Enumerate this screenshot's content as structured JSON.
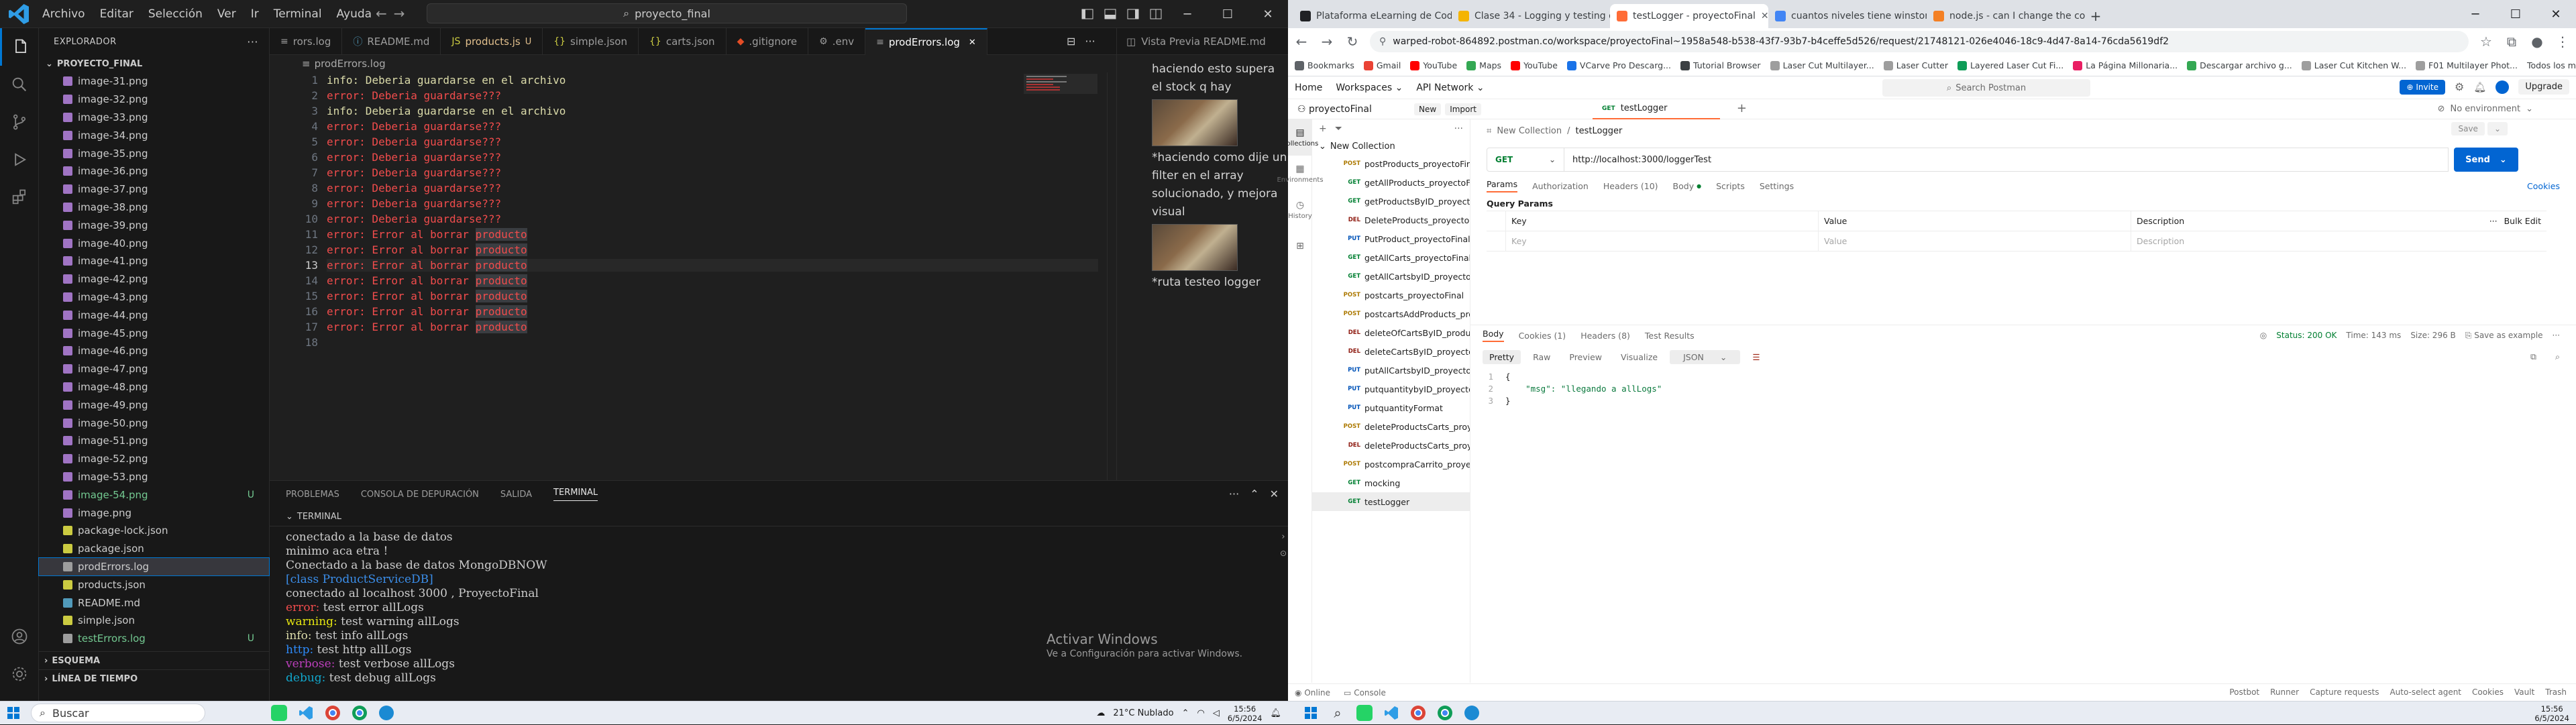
{
  "vscode": {
    "menu": [
      "Archivo",
      "Editar",
      "Selección",
      "Ver",
      "Ir",
      "Terminal",
      "Ayuda"
    ],
    "search_text": "proyecto_final",
    "explorer_title": "EXPLORADOR",
    "project_name": "PROYECTO_FINAL",
    "files": [
      {
        "name": "image-31.png",
        "type": "img"
      },
      {
        "name": "image-32.png",
        "type": "img"
      },
      {
        "name": "image-33.png",
        "type": "img"
      },
      {
        "name": "image-34.png",
        "type": "img"
      },
      {
        "name": "image-35.png",
        "type": "img"
      },
      {
        "name": "image-36.png",
        "type": "img"
      },
      {
        "name": "image-37.png",
        "type": "img"
      },
      {
        "name": "image-38.png",
        "type": "img"
      },
      {
        "name": "image-39.png",
        "type": "img"
      },
      {
        "name": "image-40.png",
        "type": "img"
      },
      {
        "name": "image-41.png",
        "type": "img"
      },
      {
        "name": "image-42.png",
        "type": "img"
      },
      {
        "name": "image-43.png",
        "type": "img"
      },
      {
        "name": "image-44.png",
        "type": "img"
      },
      {
        "name": "image-45.png",
        "type": "img"
      },
      {
        "name": "image-46.png",
        "type": "img"
      },
      {
        "name": "image-47.png",
        "type": "img"
      },
      {
        "name": "image-48.png",
        "type": "img"
      },
      {
        "name": "image-49.png",
        "type": "img"
      },
      {
        "name": "image-50.png",
        "type": "img"
      },
      {
        "name": "image-51.png",
        "type": "img"
      },
      {
        "name": "image-52.png",
        "type": "img"
      },
      {
        "name": "image-53.png",
        "type": "img"
      },
      {
        "name": "image-54.png",
        "type": "img-new",
        "badge": "U"
      },
      {
        "name": "image.png",
        "type": "img"
      },
      {
        "name": "package-lock.json",
        "type": "json"
      },
      {
        "name": "package.json",
        "type": "json"
      },
      {
        "name": "prodErrors.log",
        "type": "log",
        "selected": true
      },
      {
        "name": "products.json",
        "type": "json"
      },
      {
        "name": "README.md",
        "type": "md"
      },
      {
        "name": "simple.json",
        "type": "json"
      },
      {
        "name": "testErrors.log",
        "type": "log-new",
        "badge": "U"
      }
    ],
    "outline_sections": [
      "ESQUEMA",
      "LÍNEA DE TIEMPO"
    ],
    "tabs": [
      {
        "label": "rors.log",
        "icon": "≡",
        "color": "#9d9d9d"
      },
      {
        "label": "README.md",
        "icon": "ⓘ",
        "color": "#519aba"
      },
      {
        "label": "products.js",
        "icon": "JS",
        "color": "#cbcb41",
        "modified": "U"
      },
      {
        "label": "simple.json",
        "icon": "{}",
        "color": "#cbcb41"
      },
      {
        "label": "carts.json",
        "icon": "{}",
        "color": "#cbcb41"
      },
      {
        "label": ".gitignore",
        "icon": "◆",
        "color": "#e44d26"
      },
      {
        "label": ".env",
        "icon": "⚙",
        "color": "#9d9d9d"
      },
      {
        "label": "prodErrors.log",
        "icon": "≡",
        "color": "#9d9d9d",
        "active": true
      }
    ],
    "breadcrumb": "prodErrors.log",
    "code_lines": [
      {
        "level": "info",
        "text": " Deberia guardarse en el archivo"
      },
      {
        "level": "error",
        "text": " Deberia guardarse???"
      },
      {
        "level": "info",
        "text": " Deberia guardarse en el archivo"
      },
      {
        "level": "error",
        "text": " Deberia guardarse???"
      },
      {
        "level": "error",
        "text": " Deberia guardarse???"
      },
      {
        "level": "error",
        "text": " Deberia guardarse???"
      },
      {
        "level": "error",
        "text": " Deberia guardarse???"
      },
      {
        "level": "error",
        "text": " Deberia guardarse???"
      },
      {
        "level": "error",
        "text": " Deberia guardarse???"
      },
      {
        "level": "error",
        "text": " Deberia guardarse???"
      },
      {
        "level": "error",
        "text": " Error al borrar ",
        "hl": "producto"
      },
      {
        "level": "error",
        "text": " Error al borrar ",
        "hl": "producto"
      },
      {
        "level": "error",
        "text": " Error al borrar ",
        "hl": "producto"
      },
      {
        "level": "error",
        "text": " Error al borrar ",
        "hl": "producto"
      },
      {
        "level": "error",
        "text": " Error al borrar ",
        "hl": "producto"
      },
      {
        "level": "error",
        "text": " Error al borrar ",
        "hl": "producto"
      },
      {
        "level": "error",
        "text": " Error al borrar ",
        "hl": "producto"
      },
      {
        "level": "",
        "text": ""
      }
    ],
    "preview": {
      "tab_label": "Vista Previa README.md",
      "text_blocks": [
        "haciendo esto supera el stock q hay",
        "*haciendo como dije un filter en el array solucionado, y mejora visual",
        "*ruta testeo logger"
      ]
    },
    "panel_tabs": [
      "PROBLEMAS",
      "CONSOLA DE DEPURACIÓN",
      "SALIDA",
      "TERMINAL"
    ],
    "terminal_label": "TERMINAL",
    "terminal_lines": [
      {
        "cls": "",
        "text": "conectado a la base de datos"
      },
      {
        "cls": "",
        "text": "minimo aca etra !"
      },
      {
        "cls": "",
        "text": "Conectado a la base de datos MongoDBNOW"
      },
      {
        "cls": "t-cls",
        "text": "[class ProductServiceDB]"
      },
      {
        "cls": "",
        "text": "conectado al localhost 3000 , ProyectoFinal"
      },
      {
        "cls": "t-err",
        "prefix": "error:",
        "text": " test error allLogs"
      },
      {
        "cls": "t-warn",
        "prefix": "warning:",
        "text": " test warning allLogs"
      },
      {
        "cls": "t-info",
        "prefix": "info:",
        "text": " test info allLogs"
      },
      {
        "cls": "t-http",
        "prefix": "http:",
        "text": " test http allLogs"
      },
      {
        "cls": "t-verb",
        "prefix": "verbose:",
        "text": " test verbose allLogs"
      },
      {
        "cls": "t-dbg",
        "prefix": "debug:",
        "text": " test debug allLogs"
      }
    ],
    "activate_title": "Activar Windows",
    "activate_sub": "Ve a Configuración para activar Windows."
  },
  "chrome": {
    "tabs": [
      {
        "label": "Plataforma eLearning de Coder",
        "fav": "#202124"
      },
      {
        "label": "Clase 34 - Logging y testing d",
        "fav": "#f4b400"
      },
      {
        "label": "testLogger - proyectoFinal",
        "fav": "#ff6c37",
        "active": true
      },
      {
        "label": "cuantos niveles tiene winston",
        "fav": "#4285f4"
      },
      {
        "label": "node.js - can I change the colo",
        "fav": "#f48024"
      }
    ],
    "url": "warped-robot-864892.postman.co/workspace/proyectoFinal~1958a548-b538-43f7-93b7-b4ceffe5d526/request/21748121-026e4046-18c9-4d47-8a14-76cda5619df2",
    "bookmarks": [
      {
        "label": "Bookmarks",
        "color": "#5f6368"
      },
      {
        "label": "Gmail",
        "color": "#ea4335"
      },
      {
        "label": "YouTube",
        "color": "#ff0000"
      },
      {
        "label": "Maps",
        "color": "#34a853"
      },
      {
        "label": "YouTube",
        "color": "#ff0000"
      },
      {
        "label": "VCarve Pro Descarg...",
        "color": "#1a73e8"
      },
      {
        "label": "Tutorial Browser",
        "color": "#3c4043"
      },
      {
        "label": "Laser Cut Multilayer...",
        "color": "#9e9e9e"
      },
      {
        "label": "Laser Cutter",
        "color": "#9e9e9e"
      },
      {
        "label": "Layered Laser Cut Fi...",
        "color": "#0f9d58"
      },
      {
        "label": "La Página Millonaria...",
        "color": "#e91e63"
      },
      {
        "label": "Descargar archivo g...",
        "color": "#34a853"
      },
      {
        "label": "Laser Cut Kitchen W...",
        "color": "#9e9e9e"
      },
      {
        "label": "F01 Multilayer Phot...",
        "color": "#9e9e9e"
      }
    ],
    "all_bookmarks": "Todos los marcadores"
  },
  "postman": {
    "nav": [
      "Home",
      "Workspaces",
      "API Network"
    ],
    "search_placeholder": "Search Postman",
    "invite": "Invite",
    "upgrade": "Upgrade",
    "workspace": "proyectoFinal",
    "new_btn": "New",
    "import_btn": "Import",
    "open_tab": "testLogger",
    "environment": "No environment",
    "rail": [
      "Collections",
      "Environments",
      "History",
      ""
    ],
    "collection": "New Collection",
    "requests": [
      {
        "m": "POST",
        "label": "postProducts_proyectoFinal"
      },
      {
        "m": "GET",
        "label": "getAllProducts_proyectoFinal"
      },
      {
        "m": "GET",
        "label": "getProductsByID_proyectoFina..."
      },
      {
        "m": "DEL",
        "label": "DeleteProducts_proyectoFinal"
      },
      {
        "m": "PUT",
        "label": "PutProduct_proyectoFinal"
      },
      {
        "m": "GET",
        "label": "getAllCarts_proyectoFinal"
      },
      {
        "m": "GET",
        "label": "getAllCartsbyID_proyectoFinal"
      },
      {
        "m": "POST",
        "label": "postcarts_proyectoFinal"
      },
      {
        "m": "POST",
        "label": "postcartsAddProducts_proyec..."
      },
      {
        "m": "DEL",
        "label": "deleteOfCartsByID_products_p..."
      },
      {
        "m": "DEL",
        "label": "deleteCartsByID_proyectoFinal"
      },
      {
        "m": "PUT",
        "label": "putAllCartsbyID_proyectoFinal"
      },
      {
        "m": "PUT",
        "label": "putquantitybyID_proyectoFinal"
      },
      {
        "m": "PUT",
        "label": "putquantityFormat"
      },
      {
        "m": "POST",
        "label": "deleteProductsCarts_proyecto..."
      },
      {
        "m": "DEL",
        "label": "deleteProductsCarts_proyecto..."
      },
      {
        "m": "POST",
        "label": "postcompraCarrito_proyectoFi..."
      },
      {
        "m": "GET",
        "label": "mocking"
      },
      {
        "m": "GET",
        "label": "testLogger",
        "active": true
      }
    ],
    "crumb_parent": "New Collection",
    "crumb_current": "testLogger",
    "save": "Save",
    "method": "GET",
    "url": "http://localhost:3000/loggerTest",
    "send": "Send",
    "req_tabs": [
      "Params",
      "Authorization",
      "Headers (10)",
      "Body",
      "Scripts",
      "Settings"
    ],
    "cookies": "Cookies",
    "query_params": "Query Params",
    "kv_headers": [
      "Key",
      "Value",
      "Description"
    ],
    "bulk_edit": "Bulk Edit",
    "kv_placeholders": [
      "Key",
      "Value",
      "Description"
    ],
    "resp_tabs": [
      "Body",
      "Cookies (1)",
      "Headers (8)",
      "Test Results"
    ],
    "status": "Status: 200 OK",
    "time": "Time: 143 ms",
    "size": "Size: 296 B",
    "save_example": "Save as example",
    "formats": [
      "Pretty",
      "Raw",
      "Preview",
      "Visualize"
    ],
    "format_sel": "JSON",
    "body_lines": [
      "{",
      "    \"msg\": \"llegando a allLogs\"",
      "}"
    ],
    "footer_left": [
      "Online",
      "Console"
    ],
    "footer_right": [
      "Postbot",
      "Runner",
      "Capture requests",
      "Auto-select agent",
      "Cookies",
      "Vault",
      "Trash"
    ]
  },
  "taskbar": {
    "search": "Buscar",
    "weather": "21°C  Nublado",
    "time": "15:56",
    "date": "6/5/2024"
  }
}
